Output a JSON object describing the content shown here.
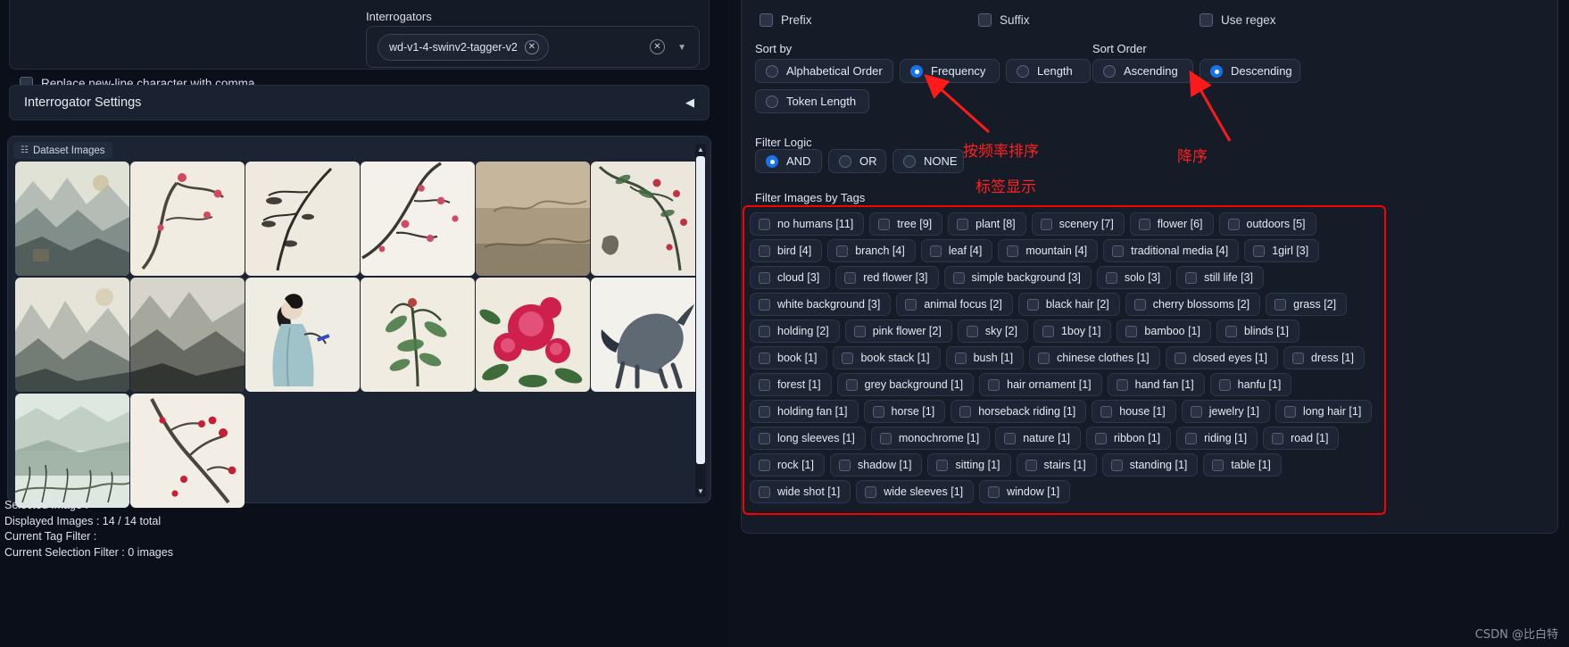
{
  "left": {
    "replace_newline_label": "Replace new-line character with comma",
    "interrogators_label": "Interrogators",
    "interrogator_token": "wd-v1-4-swinv2-tagger-v2",
    "interrogator_settings_title": "Interrogator Settings",
    "dataset_images_badge": "Dataset Images",
    "status": {
      "selected_image": "Selected Image :",
      "displayed_images": "Displayed Images : 14 / 14 total",
      "current_tag_filter": "Current Tag Filter :",
      "current_selection_filter": "Current Selection Filter : 0 images"
    }
  },
  "right": {
    "checkboxes": [
      {
        "label": "Prefix",
        "checked": false
      },
      {
        "label": "Suffix",
        "checked": false
      },
      {
        "label": "Use regex",
        "checked": false
      }
    ],
    "sort_by": {
      "label": "Sort by",
      "options": [
        "Alphabetical Order",
        "Frequency",
        "Length",
        "Token Length"
      ],
      "selected": "Frequency"
    },
    "sort_order": {
      "label": "Sort Order",
      "options": [
        "Ascending",
        "Descending"
      ],
      "selected": "Descending"
    },
    "filter_logic": {
      "label": "Filter Logic",
      "options": [
        "AND",
        "OR",
        "NONE"
      ],
      "selected": "AND"
    },
    "filter_tags_label": "Filter Images by Tags",
    "tags": [
      "no humans [11]",
      "tree [9]",
      "plant [8]",
      "scenery [7]",
      "flower [6]",
      "outdoors [5]",
      "bird [4]",
      "branch [4]",
      "leaf [4]",
      "mountain [4]",
      "traditional media [4]",
      "1girl [3]",
      "cloud [3]",
      "red flower [3]",
      "simple background [3]",
      "solo [3]",
      "still life [3]",
      "white background [3]",
      "animal focus [2]",
      "black hair [2]",
      "cherry blossoms [2]",
      "grass [2]",
      "holding [2]",
      "pink flower [2]",
      "sky [2]",
      "1boy [1]",
      "bamboo [1]",
      "blinds [1]",
      "book [1]",
      "book stack [1]",
      "bush [1]",
      "chinese clothes [1]",
      "closed eyes [1]",
      "dress [1]",
      "forest [1]",
      "grey background [1]",
      "hair ornament [1]",
      "hand fan [1]",
      "hanfu [1]",
      "holding fan [1]",
      "horse [1]",
      "horseback riding [1]",
      "house [1]",
      "jewelry [1]",
      "long hair [1]",
      "long sleeves [1]",
      "monochrome [1]",
      "nature [1]",
      "ribbon [1]",
      "riding [1]",
      "road [1]",
      "rock [1]",
      "shadow [1]",
      "sitting [1]",
      "stairs [1]",
      "standing [1]",
      "table [1]",
      "wide shot [1]",
      "wide sleeves [1]",
      "window [1]"
    ]
  },
  "annotations": {
    "sort_by_frequency": "按频率排序",
    "descending": "降序",
    "tag_display": "标签显示",
    "accent_color": "#ff0000"
  },
  "watermark": "CSDN @比白特"
}
